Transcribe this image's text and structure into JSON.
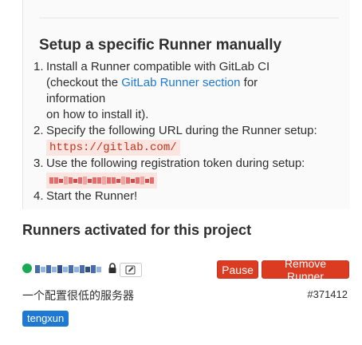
{
  "setup": {
    "title": "Setup a specific Runner manually",
    "steps": {
      "s1_num": "1.",
      "s1_a": "Install a Runner compatible with GitLab CI",
      "s1_b": "(checkout the ",
      "s1_link": "GitLab Runner section",
      "s1_c": " for information",
      "s1_d": "on how to install it).",
      "s2_num": "2.",
      "s2_a": "Specify the following URL during the Runner setup:",
      "s2_url": "https://gitlab.com/",
      "s3_num": "3.",
      "s3_a": "Use the following registration token during setup:",
      "s4_num": "4.",
      "s4_a": "Start the Runner!"
    }
  },
  "runners": {
    "title": "Runners activated for this project",
    "items": [
      {
        "status": "active",
        "status_color": "#1aaa55",
        "pause_label": "Pause",
        "remove_label": "Remove Runner",
        "description": "一个配置很低的服务器",
        "id": "#371412",
        "tag": "tengxun"
      }
    ]
  },
  "colors": {
    "danger": "#db3b21",
    "link": "#1f78d1",
    "tag": "#1f78d1"
  },
  "icons": [
    "lock-icon",
    "pencil-icon"
  ]
}
